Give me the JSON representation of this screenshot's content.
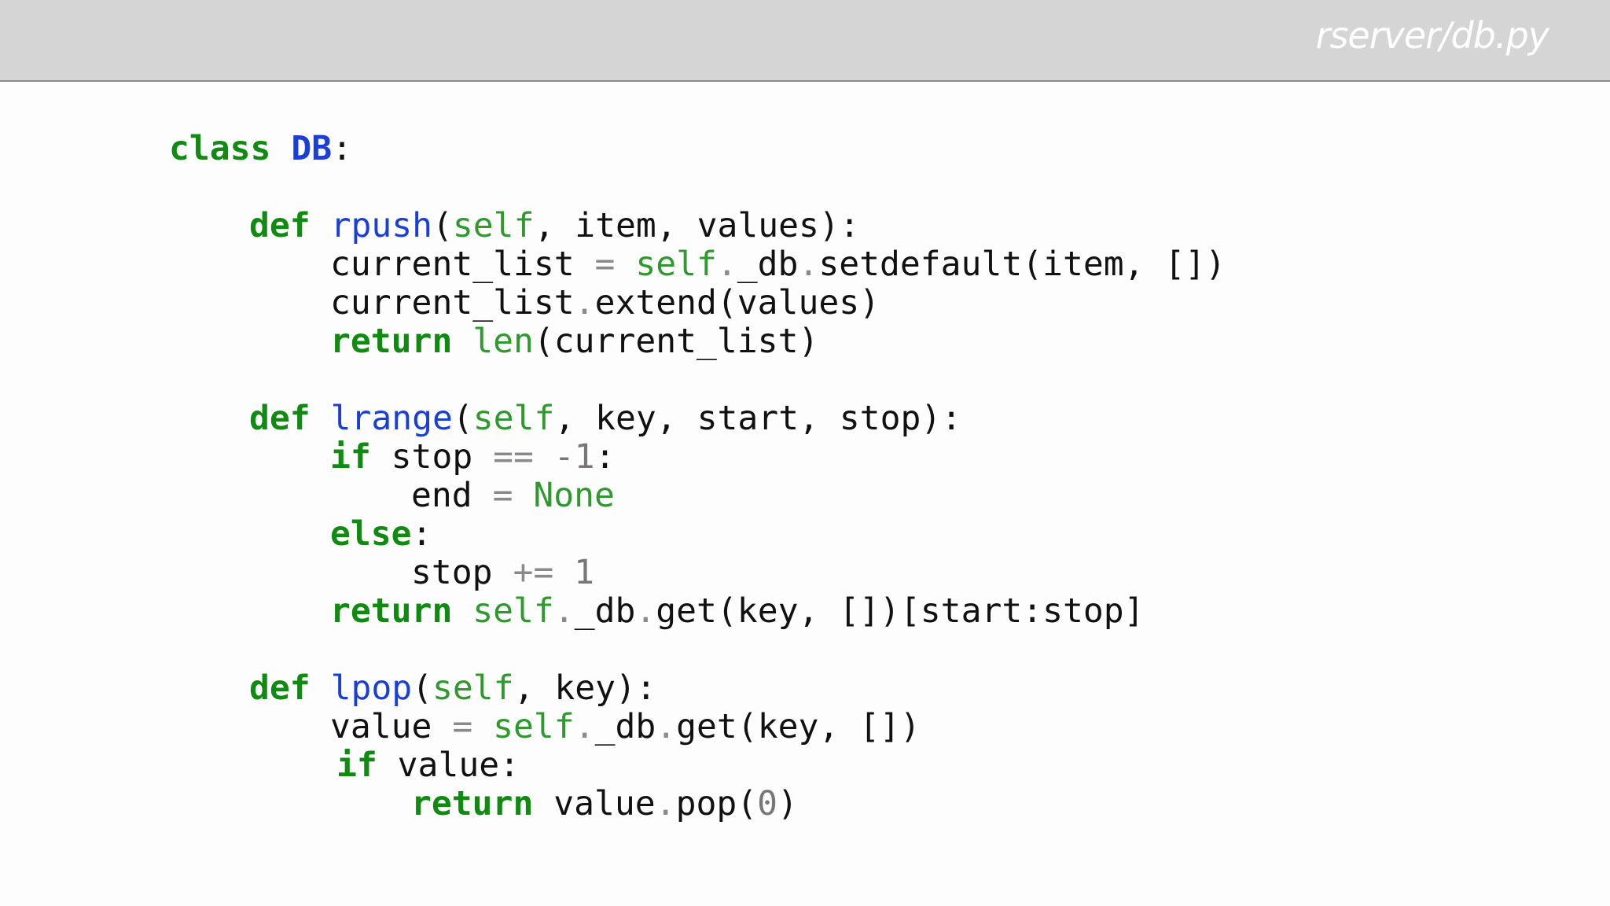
{
  "header": {
    "file_title": "rserver/db.py"
  },
  "colors": {
    "keyword": "#118a11",
    "function_name": "#1a3ed8",
    "builtin": "#2e9a2e",
    "operator": "#8a8a8a",
    "number": "#777777",
    "text": "#111111",
    "header_background": "#d5d5d5"
  },
  "code": {
    "lines": [
      [
        {
          "t": "class",
          "k": "kw"
        },
        {
          "t": " ",
          "k": "tx"
        },
        {
          "t": "DB",
          "k": "cls"
        },
        {
          "t": ":",
          "k": "tx"
        }
      ],
      [
        {
          "t": "def",
          "k": "kw"
        },
        {
          "t": " ",
          "k": "tx"
        },
        {
          "t": "rpush",
          "k": "fn"
        },
        {
          "t": "(",
          "k": "tx"
        },
        {
          "t": "self",
          "k": "bi"
        },
        {
          "t": ", item, values):",
          "k": "tx"
        }
      ],
      [
        {
          "t": "current_list ",
          "k": "tx"
        },
        {
          "t": "=",
          "k": "op"
        },
        {
          "t": " ",
          "k": "tx"
        },
        {
          "t": "self",
          "k": "bi"
        },
        {
          "t": ".",
          "k": "op"
        },
        {
          "t": "_db",
          "k": "tx"
        },
        {
          "t": ".",
          "k": "op"
        },
        {
          "t": "setdefault(item, [])",
          "k": "tx"
        }
      ],
      [
        {
          "t": "current_list",
          "k": "tx"
        },
        {
          "t": ".",
          "k": "op"
        },
        {
          "t": "extend(values)",
          "k": "tx"
        }
      ],
      [
        {
          "t": "return",
          "k": "kw"
        },
        {
          "t": " ",
          "k": "tx"
        },
        {
          "t": "len",
          "k": "bi"
        },
        {
          "t": "(current_list)",
          "k": "tx"
        }
      ],
      [
        {
          "t": "def",
          "k": "kw"
        },
        {
          "t": " ",
          "k": "tx"
        },
        {
          "t": "lrange",
          "k": "fn"
        },
        {
          "t": "(",
          "k": "tx"
        },
        {
          "t": "self",
          "k": "bi"
        },
        {
          "t": ", key, start, stop):",
          "k": "tx"
        }
      ],
      [
        {
          "t": "if",
          "k": "kw"
        },
        {
          "t": " stop ",
          "k": "tx"
        },
        {
          "t": "==",
          "k": "op"
        },
        {
          "t": " ",
          "k": "tx"
        },
        {
          "t": "-1",
          "k": "num"
        },
        {
          "t": ":",
          "k": "tx"
        }
      ],
      [
        {
          "t": "end ",
          "k": "tx"
        },
        {
          "t": "=",
          "k": "op"
        },
        {
          "t": " ",
          "k": "tx"
        },
        {
          "t": "None",
          "k": "bi"
        }
      ],
      [
        {
          "t": "else",
          "k": "kw"
        },
        {
          "t": ":",
          "k": "tx"
        }
      ],
      [
        {
          "t": "stop ",
          "k": "tx"
        },
        {
          "t": "+=",
          "k": "op"
        },
        {
          "t": " ",
          "k": "tx"
        },
        {
          "t": "1",
          "k": "num"
        }
      ],
      [
        {
          "t": "return",
          "k": "kw"
        },
        {
          "t": " ",
          "k": "tx"
        },
        {
          "t": "self",
          "k": "bi"
        },
        {
          "t": ".",
          "k": "op"
        },
        {
          "t": "_db",
          "k": "tx"
        },
        {
          "t": ".",
          "k": "op"
        },
        {
          "t": "get(key, [])[start:stop]",
          "k": "tx"
        }
      ],
      [
        {
          "t": "def",
          "k": "kw"
        },
        {
          "t": " ",
          "k": "tx"
        },
        {
          "t": "lpop",
          "k": "fn"
        },
        {
          "t": "(",
          "k": "tx"
        },
        {
          "t": "self",
          "k": "bi"
        },
        {
          "t": ", key):",
          "k": "tx"
        }
      ],
      [
        {
          "t": "value ",
          "k": "tx"
        },
        {
          "t": "=",
          "k": "op"
        },
        {
          "t": " ",
          "k": "tx"
        },
        {
          "t": "self",
          "k": "bi"
        },
        {
          "t": ".",
          "k": "op"
        },
        {
          "t": "_db",
          "k": "tx"
        },
        {
          "t": ".",
          "k": "op"
        },
        {
          "t": "get(key, [])",
          "k": "tx"
        }
      ],
      [
        {
          "t": "if",
          "k": "kw"
        },
        {
          "t": " value:",
          "k": "tx"
        }
      ],
      [
        {
          "t": "return",
          "k": "kw"
        },
        {
          "t": " value",
          "k": "tx"
        },
        {
          "t": ".",
          "k": "op"
        },
        {
          "t": "pop(",
          "k": "tx"
        },
        {
          "t": "0",
          "k": "num"
        },
        {
          "t": ")",
          "k": "tx"
        }
      ]
    ]
  }
}
